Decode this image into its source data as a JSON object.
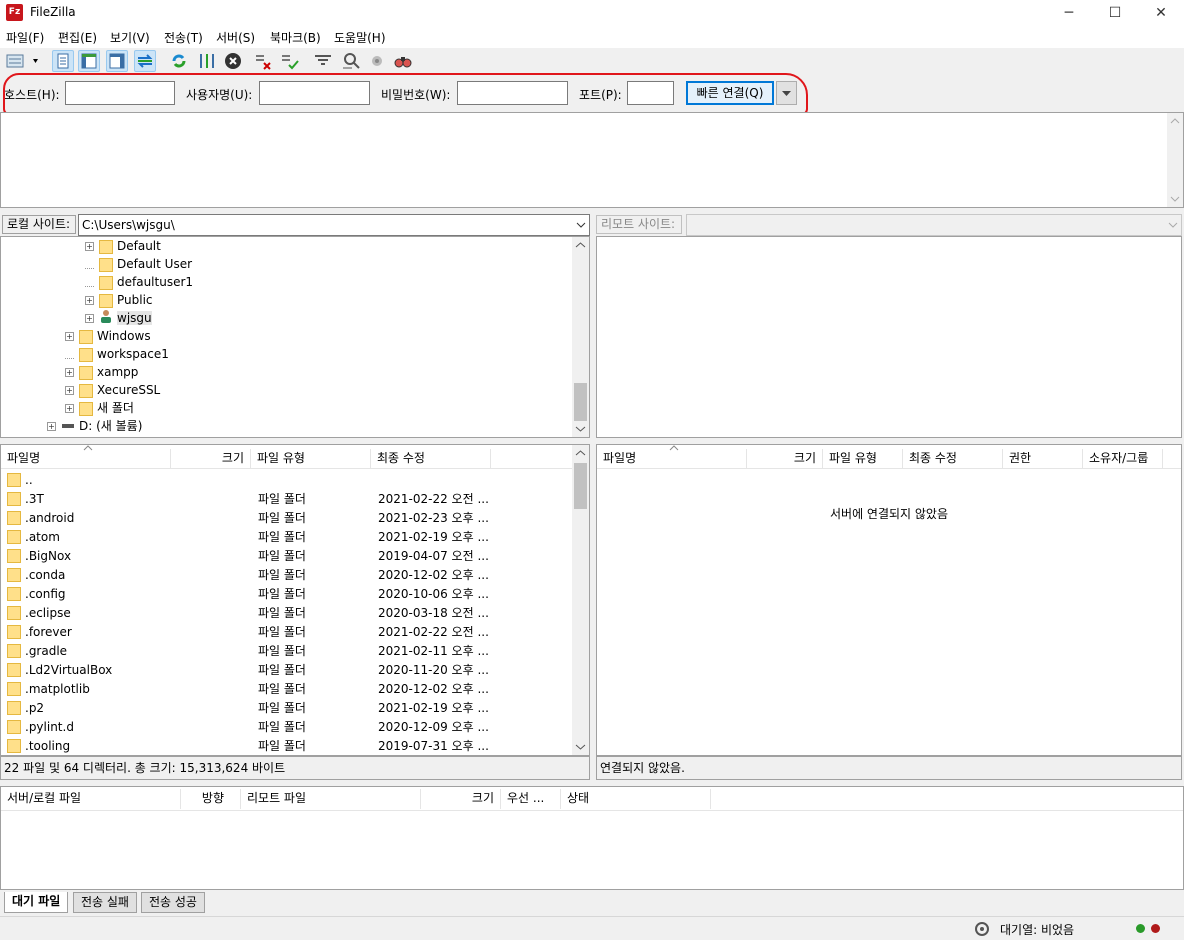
{
  "window": {
    "title": "FileZilla",
    "icon_label": "Fz",
    "minimize": "─",
    "maximize": "☐",
    "close": "✕"
  },
  "menu": [
    "파일(F)",
    "편집(E)",
    "보기(V)",
    "전송(T)",
    "서버(S)",
    "북마크(B)",
    "도움말(H)"
  ],
  "toolbar": [
    "site-manager-icon",
    "toggle-log-icon",
    "toggle-local-tree-icon",
    "toggle-remote-tree-icon",
    "toggle-queue-icon",
    "refresh-icon",
    "process-queue-icon",
    "cancel-icon",
    "disconnect-icon",
    "reconnect-icon",
    "filter-icon",
    "compare-icon",
    "sync-browse-icon",
    "search-icon"
  ],
  "quickconnect": {
    "host_label": "호스트(H):",
    "user_label": "사용자명(U):",
    "pass_label": "비밀번호(W):",
    "port_label": "포트(P):",
    "host_value": "",
    "user_value": "",
    "pass_value": "",
    "port_value": "",
    "connect_label": "빠른 연결(Q)"
  },
  "local": {
    "site_label": "로컬 사이트:",
    "path": "C:\\Users\\wjsgu\\",
    "tree": [
      {
        "label": "Default",
        "indent": 1,
        "expander": true,
        "icon": "folder"
      },
      {
        "label": "Default User",
        "indent": 1,
        "expander": false,
        "icon": "folder"
      },
      {
        "label": "defaultuser1",
        "indent": 1,
        "expander": false,
        "icon": "folder"
      },
      {
        "label": "Public",
        "indent": 1,
        "expander": true,
        "icon": "folder"
      },
      {
        "label": "wjsgu",
        "indent": 1,
        "expander": true,
        "icon": "user"
      },
      {
        "label": "Windows",
        "indent": 0,
        "expander": true,
        "icon": "folder"
      },
      {
        "label": "workspace1",
        "indent": 0,
        "expander": false,
        "icon": "folder"
      },
      {
        "label": "xampp",
        "indent": 0,
        "expander": true,
        "icon": "folder"
      },
      {
        "label": "XecureSSL",
        "indent": 0,
        "expander": true,
        "icon": "folder"
      },
      {
        "label": "새 폴더",
        "indent": 0,
        "expander": true,
        "icon": "folder"
      },
      {
        "label": "D: (새 볼륨)",
        "indent": -1,
        "expander": true,
        "icon": "drive"
      }
    ],
    "columns": [
      "파일명",
      "크기",
      "파일 유형",
      "최종 수정"
    ],
    "files": [
      {
        "name": "..",
        "size": "",
        "type": "",
        "modified": ""
      },
      {
        "name": ".3T",
        "size": "",
        "type": "파일 폴더",
        "modified": "2021-02-22 오전 ..."
      },
      {
        "name": ".android",
        "size": "",
        "type": "파일 폴더",
        "modified": "2021-02-23 오후 ..."
      },
      {
        "name": ".atom",
        "size": "",
        "type": "파일 폴더",
        "modified": "2021-02-19 오후 ..."
      },
      {
        "name": ".BigNox",
        "size": "",
        "type": "파일 폴더",
        "modified": "2019-04-07 오전 ..."
      },
      {
        "name": ".conda",
        "size": "",
        "type": "파일 폴더",
        "modified": "2020-12-02 오후 ..."
      },
      {
        "name": ".config",
        "size": "",
        "type": "파일 폴더",
        "modified": "2020-10-06 오후 ..."
      },
      {
        "name": ".eclipse",
        "size": "",
        "type": "파일 폴더",
        "modified": "2020-03-18 오전 ..."
      },
      {
        "name": ".forever",
        "size": "",
        "type": "파일 폴더",
        "modified": "2021-02-22 오전 ..."
      },
      {
        "name": ".gradle",
        "size": "",
        "type": "파일 폴더",
        "modified": "2021-02-11 오후 ..."
      },
      {
        "name": ".Ld2VirtualBox",
        "size": "",
        "type": "파일 폴더",
        "modified": "2020-11-20 오후 ..."
      },
      {
        "name": ".matplotlib",
        "size": "",
        "type": "파일 폴더",
        "modified": "2020-12-02 오후 ..."
      },
      {
        "name": ".p2",
        "size": "",
        "type": "파일 폴더",
        "modified": "2021-02-19 오후 ..."
      },
      {
        "name": ".pylint.d",
        "size": "",
        "type": "파일 폴더",
        "modified": "2020-12-09 오후 ..."
      },
      {
        "name": ".tooling",
        "size": "",
        "type": "파일 폴더",
        "modified": "2019-07-31 오후 ..."
      }
    ],
    "status": "22 파일 및 64 디렉터리. 총 크기: 15,313,624 바이트"
  },
  "remote": {
    "site_label": "리모트 사이트:",
    "columns": [
      "파일명",
      "크기",
      "파일 유형",
      "최종 수정",
      "권한",
      "소유자/그룹"
    ],
    "empty_message": "서버에 연결되지 않았음",
    "status": "연결되지 않았음."
  },
  "queue": {
    "columns": [
      "서버/로컬 파일",
      "방향",
      "리모트 파일",
      "크기",
      "우선 ...",
      "상태"
    ],
    "tabs": [
      "대기 파일",
      "전송 실패",
      "전송 성공"
    ],
    "active_tab": 0
  },
  "statusbar": {
    "queue_text": "대기열: 비었음"
  },
  "colors": {
    "highlight": "#e0161b",
    "folder": "#ffe08a",
    "accent": "#0078d7"
  }
}
